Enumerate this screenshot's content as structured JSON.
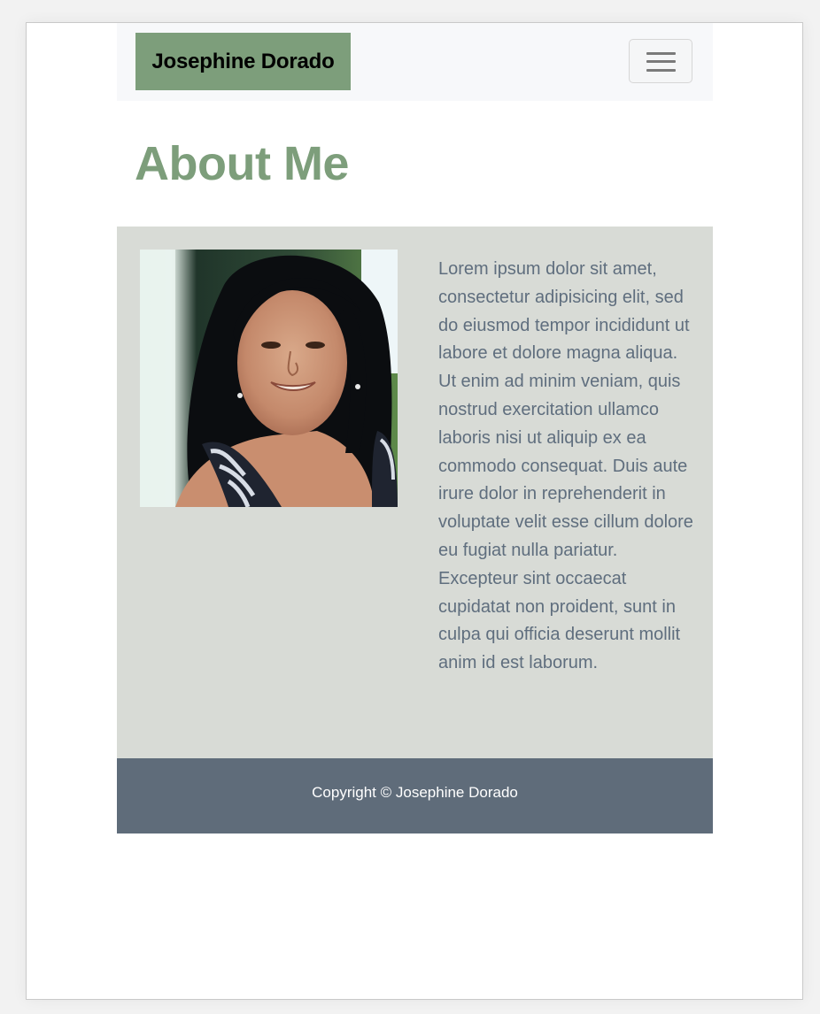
{
  "navbar": {
    "brand": "Josephine Dorado",
    "toggle_icon": "hamburger-menu-icon"
  },
  "page": {
    "title": "About Me"
  },
  "about": {
    "photo_subject": "portrait",
    "bio": "Lorem ipsum dolor sit amet, consectetur adipisicing elit, sed do eiusmod tempor incididunt ut labore et dolore magna aliqua. Ut enim ad minim veniam, quis nostrud exercitation ullamco laboris nisi ut aliquip ex ea commodo consequat. Duis aute irure dolor in reprehenderit in voluptate velit esse cillum dolore eu fugiat nulla pariatur. Excepteur sint occaecat cupidatat non proident, sunt in culpa qui officia deserunt mollit anim id est laborum."
  },
  "footer": {
    "copyright": "Copyright © Josephine Dorado"
  },
  "colors": {
    "brand_green": "#7d9e7b",
    "section_bg": "#d8dbd6",
    "footer_bg": "#5f6c7a",
    "body_text": "#5f6e7e",
    "navbar_bg": "#f7f8fa"
  }
}
